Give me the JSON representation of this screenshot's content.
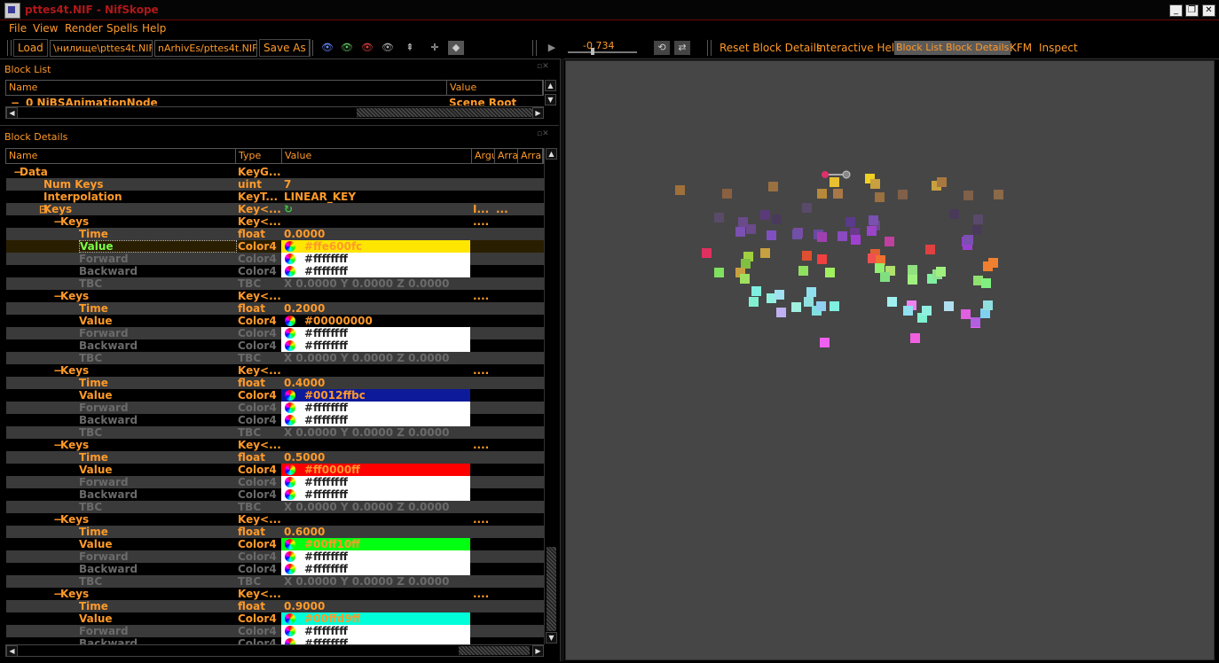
{
  "window": {
    "title": "pttes4t.NIF - NifSkope",
    "controls": [
      "_",
      "❐",
      "✕"
    ]
  },
  "menu": [
    "File",
    "View",
    "Render",
    "Spells",
    "Help"
  ],
  "toolbar": {
    "load": "Load",
    "load_path": "\\нилище\\pttes4t.NIF",
    "save_path": "nArhivEs/pttes4t.NIF",
    "save_as": "Save As",
    "time_value": "-0.734",
    "reset_block_details": "Reset Block Details",
    "interactive_help": "Interactive Help",
    "block_list": "Block List",
    "block_details": "Block Details",
    "kfm": "KFM",
    "inspect": "Inspect"
  },
  "block_list": {
    "title": "Block List",
    "columns": [
      "Name",
      "Value"
    ],
    "row": {
      "name": "0 NiBSAnimationNode",
      "value": "Scene Root"
    }
  },
  "block_details": {
    "title": "Block Details",
    "columns": [
      "Name",
      "Type",
      "Value",
      "Argu",
      "Arra",
      "Arra"
    ],
    "rows": [
      {
        "expander": "−",
        "name": "Data",
        "type": "KeyG...",
        "value": "",
        "arg": "",
        "arr": "",
        "indent": 0,
        "kind": "text",
        "alt": false
      },
      {
        "expander": "",
        "name": "Num Keys",
        "type": "uint",
        "value": "7",
        "arg": "",
        "arr": "",
        "indent": 1,
        "kind": "text",
        "alt": true
      },
      {
        "expander": "",
        "name": "Interpolation",
        "type": "KeyT...",
        "value": "LINEAR_KEY",
        "arg": "",
        "arr": "",
        "indent": 1,
        "kind": "text",
        "alt": false
      },
      {
        "expander": "⊟",
        "name": "Keys",
        "type": "Key<...",
        "value": "↻",
        "arg": "I...",
        "arr": "...",
        "indent": 1,
        "kind": "text",
        "alt": true
      },
      {
        "expander": "−",
        "name": "Keys",
        "type": "Key<...",
        "value": "",
        "arg": "",
        "arr": "....",
        "indent": 2,
        "kind": "text",
        "alt": false
      },
      {
        "expander": "",
        "name": "Time",
        "type": "float",
        "value": "0.0000",
        "indent": 3,
        "kind": "text",
        "alt": true
      },
      {
        "expander": "",
        "name": "Value",
        "type": "Color4",
        "value": "#ffe600fc",
        "color": "#ffe600",
        "indent": 3,
        "kind": "color",
        "alt": false,
        "selected": true
      },
      {
        "expander": "",
        "name": "Forward",
        "type": "Color4",
        "value": "#ffffffff",
        "indent": 3,
        "kind": "white",
        "alt": true,
        "dim": true
      },
      {
        "expander": "",
        "name": "Backward",
        "type": "Color4",
        "value": "#ffffffff",
        "indent": 3,
        "kind": "white",
        "alt": false,
        "dim": true
      },
      {
        "expander": "",
        "name": "TBC",
        "type": "TBC",
        "value": "X 0.0000 Y 0.0000 Z 0.0000",
        "indent": 3,
        "kind": "text",
        "alt": true,
        "dim": true
      },
      {
        "expander": "−",
        "name": "Keys",
        "type": "Key<...",
        "value": "",
        "arg": "",
        "arr": "....",
        "indent": 2,
        "kind": "text",
        "alt": false
      },
      {
        "expander": "",
        "name": "Time",
        "type": "float",
        "value": "0.2000",
        "indent": 3,
        "kind": "text",
        "alt": true
      },
      {
        "expander": "",
        "name": "Value",
        "type": "Color4",
        "value": "#00000000",
        "color": "#000000",
        "indent": 3,
        "kind": "color",
        "alt": false
      },
      {
        "expander": "",
        "name": "Forward",
        "type": "Color4",
        "value": "#ffffffff",
        "indent": 3,
        "kind": "white",
        "alt": true,
        "dim": true
      },
      {
        "expander": "",
        "name": "Backward",
        "type": "Color4",
        "value": "#ffffffff",
        "indent": 3,
        "kind": "white",
        "alt": false,
        "dim": true
      },
      {
        "expander": "",
        "name": "TBC",
        "type": "TBC",
        "value": "X 0.0000 Y 0.0000 Z 0.0000",
        "indent": 3,
        "kind": "text",
        "alt": true,
        "dim": true
      },
      {
        "expander": "−",
        "name": "Keys",
        "type": "Key<...",
        "value": "",
        "arg": "",
        "arr": "....",
        "indent": 2,
        "kind": "text",
        "alt": false
      },
      {
        "expander": "",
        "name": "Time",
        "type": "float",
        "value": "0.4000",
        "indent": 3,
        "kind": "text",
        "alt": true
      },
      {
        "expander": "",
        "name": "Value",
        "type": "Color4",
        "value": "#0012ffbc",
        "color": "#0d1a9a",
        "indent": 3,
        "kind": "color",
        "alt": false
      },
      {
        "expander": "",
        "name": "Forward",
        "type": "Color4",
        "value": "#ffffffff",
        "indent": 3,
        "kind": "white",
        "alt": true,
        "dim": true
      },
      {
        "expander": "",
        "name": "Backward",
        "type": "Color4",
        "value": "#ffffffff",
        "indent": 3,
        "kind": "white",
        "alt": false,
        "dim": true
      },
      {
        "expander": "",
        "name": "TBC",
        "type": "TBC",
        "value": "X 0.0000 Y 0.0000 Z 0.0000",
        "indent": 3,
        "kind": "text",
        "alt": true,
        "dim": true
      },
      {
        "expander": "−",
        "name": "Keys",
        "type": "Key<...",
        "value": "",
        "arg": "",
        "arr": "....",
        "indent": 2,
        "kind": "text",
        "alt": false
      },
      {
        "expander": "",
        "name": "Time",
        "type": "float",
        "value": "0.5000",
        "indent": 3,
        "kind": "text",
        "alt": true
      },
      {
        "expander": "",
        "name": "Value",
        "type": "Color4",
        "value": "#ff0000ff",
        "color": "#ff0000",
        "indent": 3,
        "kind": "color",
        "alt": false
      },
      {
        "expander": "",
        "name": "Forward",
        "type": "Color4",
        "value": "#ffffffff",
        "indent": 3,
        "kind": "white",
        "alt": true,
        "dim": true
      },
      {
        "expander": "",
        "name": "Backward",
        "type": "Color4",
        "value": "#ffffffff",
        "indent": 3,
        "kind": "white",
        "alt": false,
        "dim": true
      },
      {
        "expander": "",
        "name": "TBC",
        "type": "TBC",
        "value": "X 0.0000 Y 0.0000 Z 0.0000",
        "indent": 3,
        "kind": "text",
        "alt": true,
        "dim": true
      },
      {
        "expander": "−",
        "name": "Keys",
        "type": "Key<...",
        "value": "",
        "arg": "",
        "arr": "....",
        "indent": 2,
        "kind": "text",
        "alt": false
      },
      {
        "expander": "",
        "name": "Time",
        "type": "float",
        "value": "0.6000",
        "indent": 3,
        "kind": "text",
        "alt": true
      },
      {
        "expander": "",
        "name": "Value",
        "type": "Color4",
        "value": "#00ff10ff",
        "color": "#00ff10",
        "indent": 3,
        "kind": "color",
        "alt": false
      },
      {
        "expander": "",
        "name": "Forward",
        "type": "Color4",
        "value": "#ffffffff",
        "indent": 3,
        "kind": "white",
        "alt": true,
        "dim": true
      },
      {
        "expander": "",
        "name": "Backward",
        "type": "Color4",
        "value": "#ffffffff",
        "indent": 3,
        "kind": "white",
        "alt": false,
        "dim": true
      },
      {
        "expander": "",
        "name": "TBC",
        "type": "TBC",
        "value": "X 0.0000 Y 0.0000 Z 0.0000",
        "indent": 3,
        "kind": "text",
        "alt": true,
        "dim": true
      },
      {
        "expander": "−",
        "name": "Keys",
        "type": "Key<...",
        "value": "",
        "arg": "",
        "arr": "....",
        "indent": 2,
        "kind": "text",
        "alt": false
      },
      {
        "expander": "",
        "name": "Time",
        "type": "float",
        "value": "0.9000",
        "indent": 3,
        "kind": "text",
        "alt": true
      },
      {
        "expander": "",
        "name": "Value",
        "type": "Color4",
        "value": "#00ffd9ff",
        "color": "#00ffd9",
        "indent": 3,
        "kind": "color",
        "alt": false
      },
      {
        "expander": "",
        "name": "Forward",
        "type": "Color4",
        "value": "#ffffffff",
        "indent": 3,
        "kind": "white",
        "alt": true,
        "dim": true
      },
      {
        "expander": "",
        "name": "Backward",
        "type": "Color4",
        "value": "#ffffffff",
        "indent": 3,
        "kind": "white",
        "alt": false,
        "dim": true
      }
    ]
  },
  "viewport": {
    "background": "#464646",
    "particles": [
      {
        "c": "#a0703a"
      },
      {
        "c": "#8a6040"
      },
      {
        "c": "#9a7040"
      },
      {
        "c": "#b8883a"
      },
      {
        "c": "#e8c030"
      },
      {
        "c": "#f0d020"
      },
      {
        "c": "#a87848"
      },
      {
        "c": "#c8a040"
      },
      {
        "c": "#9a7040"
      },
      {
        "c": "#806048"
      },
      {
        "c": "#c8a040"
      },
      {
        "c": "#a87840"
      },
      {
        "c": "#806048"
      },
      {
        "c": "#8a6a48"
      },
      {
        "c": "#5a4a6a"
      },
      {
        "c": "#6a4a8a"
      },
      {
        "c": "#5a3a7a"
      },
      {
        "c": "#6a4a8a"
      },
      {
        "c": "#4a3a5a"
      },
      {
        "c": "#5a4a6a"
      },
      {
        "c": "#7a4aa0"
      },
      {
        "c": "#6a4aa0"
      },
      {
        "c": "#5a3a8a"
      },
      {
        "c": "#6a3a8a"
      },
      {
        "c": "#4a3a5a"
      },
      {
        "c": "#5a4a6a"
      },
      {
        "c": "#4a3a5a"
      },
      {
        "c": "#6a4a8a"
      },
      {
        "c": "#7a50b0"
      },
      {
        "c": "#8050c0"
      },
      {
        "c": "#7050a8"
      },
      {
        "c": "#a040b0"
      },
      {
        "c": "#8a4ac0"
      },
      {
        "c": "#9a44c8"
      },
      {
        "c": "#a040d0"
      },
      {
        "c": "#c040a0"
      },
      {
        "c": "#7a50b0"
      },
      {
        "c": "#9040c8"
      },
      {
        "c": "#9a40d0"
      },
      {
        "c": "#7a50b0"
      },
      {
        "c": "#e03060"
      },
      {
        "c": "#a0d040"
      },
      {
        "c": "#80c040"
      },
      {
        "c": "#c8a040"
      },
      {
        "c": "#e05030"
      },
      {
        "c": "#f04040"
      },
      {
        "c": "#e06030"
      },
      {
        "c": "#f05050"
      },
      {
        "c": "#f07030"
      },
      {
        "c": "#e04040"
      },
      {
        "c": "#f08030"
      },
      {
        "c": "#80e060"
      },
      {
        "c": "#c8a040"
      },
      {
        "c": "#a0e060"
      },
      {
        "c": "#90e060"
      },
      {
        "c": "#a0f060"
      },
      {
        "c": "#90f070"
      },
      {
        "c": "#b0e070"
      },
      {
        "c": "#80e080"
      },
      {
        "c": "#90e080"
      },
      {
        "c": "#a0f080"
      },
      {
        "c": "#80f0a0"
      },
      {
        "c": "#90e090"
      },
      {
        "c": "#a0f080"
      },
      {
        "c": "#90e070"
      },
      {
        "c": "#80f080"
      },
      {
        "c": "#80f0e0"
      },
      {
        "c": "#90e0f0"
      },
      {
        "c": "#80f0d0"
      },
      {
        "c": "#90f0e0"
      },
      {
        "c": "#a0e0f0"
      },
      {
        "c": "#c0b0f0"
      },
      {
        "c": "#90e0e0"
      },
      {
        "c": "#a0f0e0"
      },
      {
        "c": "#80e0e0"
      },
      {
        "c": "#90d0f0"
      },
      {
        "c": "#80f0e0"
      },
      {
        "c": "#a0f0f0"
      },
      {
        "c": "#f080f0"
      },
      {
        "c": "#90e0f0"
      },
      {
        "c": "#80f0d0"
      },
      {
        "c": "#90f0e0"
      },
      {
        "c": "#b0e0f0"
      },
      {
        "c": "#e060e0"
      },
      {
        "c": "#f060f0"
      },
      {
        "c": "#80d0f0"
      }
    ]
  }
}
